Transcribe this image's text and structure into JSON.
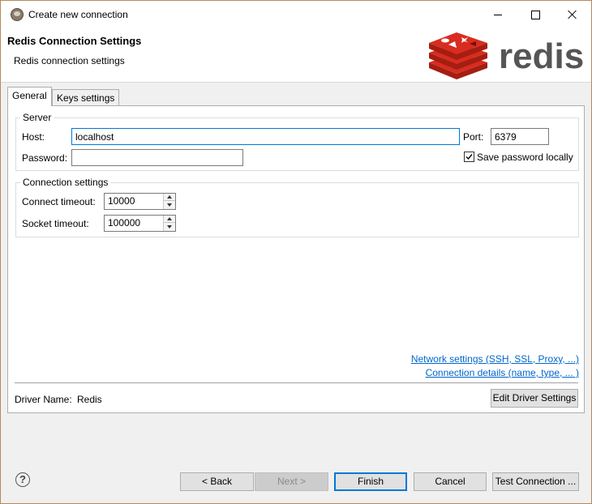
{
  "window": {
    "title": "Create new connection",
    "icon": "app-icon"
  },
  "header": {
    "title": "Redis Connection Settings",
    "subtitle": "Redis connection settings",
    "logo_text": "redis",
    "logo_colors": {
      "primary": "#d82c20",
      "dark": "#a41e11",
      "text": "#555555"
    }
  },
  "tabs": [
    {
      "label": "General",
      "selected": true
    },
    {
      "label": "Keys settings",
      "selected": false
    }
  ],
  "server": {
    "group_label": "Server",
    "host_label": "Host:",
    "host_value": "localhost",
    "port_label": "Port:",
    "port_value": "6379",
    "password_label": "Password:",
    "password_value": "",
    "save_password_label": "Save password locally",
    "save_password_checked": true
  },
  "connection": {
    "group_label": "Connection settings",
    "connect_timeout_label": "Connect timeout:",
    "connect_timeout_value": "10000",
    "socket_timeout_label": "Socket timeout:",
    "socket_timeout_value": "100000"
  },
  "links": {
    "network": "Network settings (SSH, SSL, Proxy, ...)",
    "details": "Connection details (name, type, ... )"
  },
  "driver": {
    "label": "Driver Name:",
    "value": "Redis",
    "edit_button": "Edit Driver Settings"
  },
  "footer": {
    "help": "?",
    "back": "< Back",
    "next": "Next >",
    "finish": "Finish",
    "cancel": "Cancel",
    "test": "Test Connection ..."
  },
  "colors": {
    "link": "#0066cc",
    "focus": "#0078d7"
  }
}
